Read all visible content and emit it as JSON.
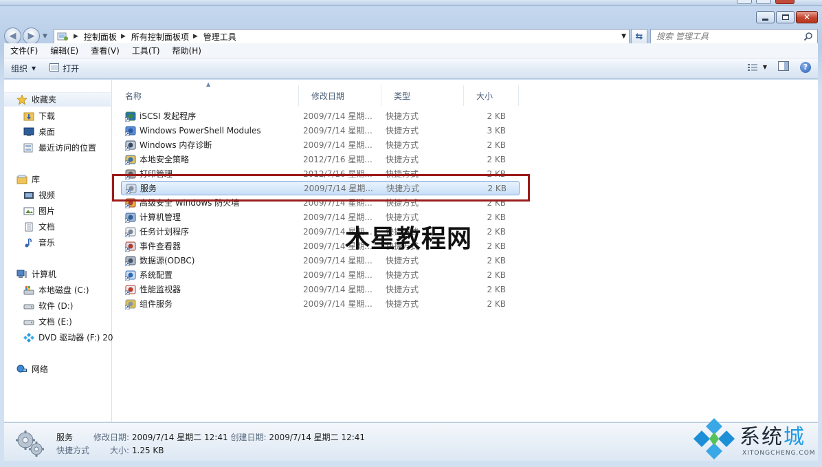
{
  "window": {
    "caption": {
      "minimize": "—",
      "maximize": "□",
      "close": "✕"
    }
  },
  "address_bar": {
    "breadcrumbs": [
      "控制面板",
      "所有控制面板项",
      "管理工具"
    ]
  },
  "search": {
    "placeholder": "搜索 管理工具"
  },
  "menu": [
    "文件(F)",
    "编辑(E)",
    "查看(V)",
    "工具(T)",
    "帮助(H)"
  ],
  "toolbar": {
    "organize": "组织",
    "open": "打开"
  },
  "nav": {
    "favorites": {
      "label": "收藏夹",
      "items": [
        "下载",
        "桌面",
        "最近访问的位置"
      ]
    },
    "libraries": {
      "label": "库",
      "items": [
        "视频",
        "图片",
        "文档",
        "音乐"
      ]
    },
    "computer": {
      "label": "计算机",
      "items": [
        "本地磁盘 (C:)",
        "软件 (D:)",
        "文档 (E:)",
        "DVD 驱动器 (F:) 20"
      ]
    },
    "network": {
      "label": "网络"
    }
  },
  "columns": [
    "名称",
    "修改日期",
    "类型",
    "大小"
  ],
  "files": [
    {
      "name": "iSCSI 发起程序",
      "date": "2009/7/14 星期...",
      "type": "快捷方式",
      "size": "2 KB",
      "icon": "iscsi-icon"
    },
    {
      "name": "Windows PowerShell Modules",
      "date": "2009/7/14 星期...",
      "type": "快捷方式",
      "size": "3 KB",
      "icon": "powershell-icon"
    },
    {
      "name": "Windows 内存诊断",
      "date": "2009/7/14 星期...",
      "type": "快捷方式",
      "size": "2 KB",
      "icon": "memory-diagnostic-icon"
    },
    {
      "name": "本地安全策略",
      "date": "2012/7/16 星期...",
      "type": "快捷方式",
      "size": "2 KB",
      "icon": "security-policy-icon"
    },
    {
      "name": "打印管理",
      "date": "2012/7/16 星期...",
      "type": "快捷方式",
      "size": "2 KB",
      "icon": "print-management-icon"
    },
    {
      "name": "服务",
      "date": "2009/7/14 星期...",
      "type": "快捷方式",
      "size": "2 KB",
      "icon": "services-gear-icon"
    },
    {
      "name": "高级安全 Windows 防火墙",
      "date": "2009/7/14 星期...",
      "type": "快捷方式",
      "size": "2 KB",
      "icon": "firewall-icon"
    },
    {
      "name": "计算机管理",
      "date": "2009/7/14 星期...",
      "type": "快捷方式",
      "size": "2 KB",
      "icon": "computer-management-icon"
    },
    {
      "name": "任务计划程序",
      "date": "2009/7/14 星期...",
      "type": "快捷方式",
      "size": "2 KB",
      "icon": "task-scheduler-icon"
    },
    {
      "name": "事件查看器",
      "date": "2009/7/14 星期...",
      "type": "快捷方式",
      "size": "2 KB",
      "icon": "event-viewer-icon"
    },
    {
      "name": "数据源(ODBC)",
      "date": "2009/7/14 星期...",
      "type": "快捷方式",
      "size": "2 KB",
      "icon": "odbc-icon"
    },
    {
      "name": "系统配置",
      "date": "2009/7/14 星期...",
      "type": "快捷方式",
      "size": "2 KB",
      "icon": "system-config-icon"
    },
    {
      "name": "性能监视器",
      "date": "2009/7/14 星期...",
      "type": "快捷方式",
      "size": "2 KB",
      "icon": "performance-monitor-icon"
    },
    {
      "name": "组件服务",
      "date": "2009/7/14 星期...",
      "type": "快捷方式",
      "size": "2 KB",
      "icon": "component-services-icon"
    }
  ],
  "selected_index": 5,
  "details": {
    "name": "服务",
    "type": "快捷方式",
    "modified_label": "修改日期:",
    "modified_value": "2009/7/14 星期二 12:41",
    "created_label": "创建日期:",
    "created_value": "2009/7/14 星期二 12:41",
    "size_label": "大小:",
    "size_value": "1.25 KB"
  },
  "watermarks": {
    "center": "木星教程网",
    "brand_cn_a": "系统",
    "brand_cn_b": "城",
    "brand_en": "XITONGCHENG.COM"
  },
  "colors": {
    "highlight_box": "#9b1c1a",
    "selection": "#c7dff8",
    "brand_blue": "#1d9be3"
  }
}
